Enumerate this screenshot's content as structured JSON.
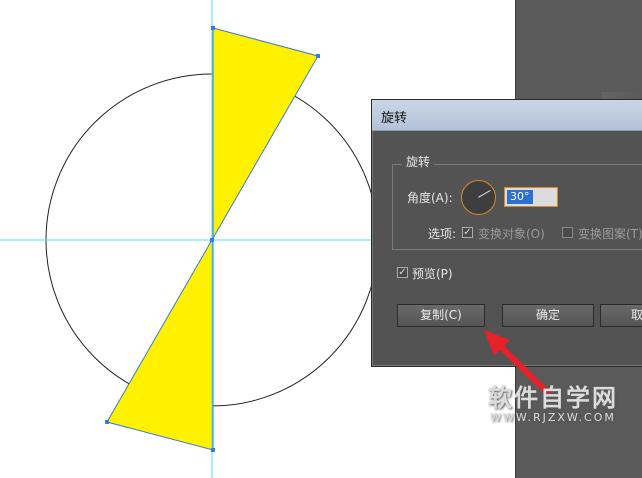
{
  "dialog": {
    "title": "旋转",
    "group_label": "旋转",
    "angle_label": "角度(A):",
    "angle_value": "30°",
    "options_label": "选项:",
    "option_transform_objects": "变换对象(O)",
    "option_transform_patterns": "变换图案(T)",
    "preview_label": "预览(P)",
    "copy_button": "复制(C)",
    "ok_button": "确定",
    "cancel_button": "取消"
  },
  "watermark": {
    "text": "软件自学网",
    "url": "WWW.RJZXW.COM"
  },
  "colors": {
    "shape_fill": "#FFF100",
    "selection_stroke": "#3a7bd5",
    "guide_line": "#4fe4f4",
    "arrow": "#e8202a"
  }
}
